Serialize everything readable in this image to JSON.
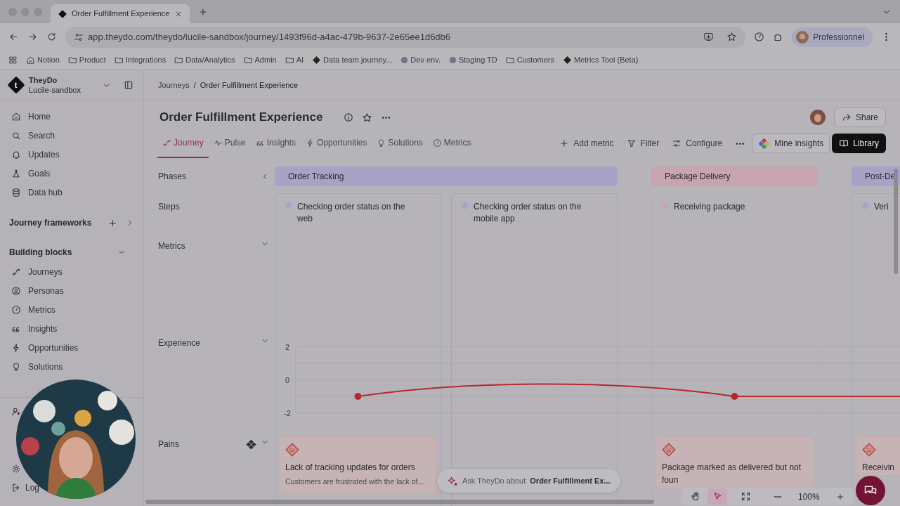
{
  "browser": {
    "tab": {
      "title": "Order Fulfillment Experience",
      "selected": true
    },
    "url": "app.theydo.com/theydo/lucile-sandbox/journey/1493f96d-a4ac-479b-9637-2e65ee1d6db6",
    "profile": "Professionnel",
    "bookmarks": [
      {
        "label": "Notion",
        "kind": "home"
      },
      {
        "label": "Product",
        "kind": "folder"
      },
      {
        "label": "Integrations",
        "kind": "folder"
      },
      {
        "label": "Data/Analytics",
        "kind": "folder"
      },
      {
        "label": "Admin",
        "kind": "folder"
      },
      {
        "label": "AI",
        "kind": "folder"
      },
      {
        "label": "Data team journey...",
        "kind": "logo"
      },
      {
        "label": "Dev env.",
        "kind": "site"
      },
      {
        "label": "Staging TD",
        "kind": "site"
      },
      {
        "label": "Customers",
        "kind": "folder"
      },
      {
        "label": "Metrics Tool (Beta)",
        "kind": "logo"
      }
    ]
  },
  "sidebar": {
    "logo": "t",
    "workspace": "TheyDo",
    "project": "Lucile-sandbox",
    "nav": [
      {
        "label": "Home"
      },
      {
        "label": "Search"
      },
      {
        "label": "Updates"
      },
      {
        "label": "Goals"
      },
      {
        "label": "Data hub"
      }
    ],
    "frameworks": "Journey frameworks",
    "blocks": {
      "title": "Building blocks",
      "expanded": true,
      "items": [
        {
          "label": "Journeys"
        },
        {
          "label": "Personas"
        },
        {
          "label": "Metrics"
        },
        {
          "label": "Insights"
        },
        {
          "label": "Opportunities"
        },
        {
          "label": "Solutions"
        }
      ]
    },
    "footer_label": "Log"
  },
  "main": {
    "breadcrumbs": [
      "Journeys",
      "Order Fulfillment Experience"
    ],
    "breadcrumb_separator": "/",
    "title": "Order Fulfillment Experience",
    "share_button": "Share",
    "tabs": [
      {
        "label": "Journey",
        "selected": true
      },
      {
        "label": "Pulse",
        "selected": false
      },
      {
        "label": "Insights",
        "selected": false
      },
      {
        "label": "Opportunities",
        "selected": false
      },
      {
        "label": "Solutions",
        "selected": false
      },
      {
        "label": "Metrics",
        "selected": false
      }
    ],
    "actions": [
      "Add metric",
      "Filter",
      "Configure"
    ],
    "mine_button": "Mine insights",
    "library_button": "Library"
  },
  "board": {
    "rows": [
      {
        "label": "Phases",
        "expanded": true
      },
      {
        "label": "Steps"
      },
      {
        "label": "Metrics",
        "expanded": true
      },
      {
        "label": "Experience",
        "expanded": true
      },
      {
        "label": "Pains",
        "expanded": true
      }
    ],
    "phases": [
      {
        "name": "Order Tracking",
        "color": "#a6a3c6",
        "steps": [
          {
            "title": "Checking order status on the web",
            "pain": {
              "title": "Lack of tracking updates for orders",
              "desc": "Customers are frustrated with the lack of..."
            }
          },
          {
            "title": "Checking order status on the mobile app"
          }
        ]
      },
      {
        "name": "Package Delivery",
        "color": "#c8a4b0",
        "steps": [
          {
            "title": "Receiving package",
            "pain": {
              "title": "Package marked as delivered but not foun"
            }
          }
        ]
      },
      {
        "name": "Post-De",
        "color": "#a6a3c6",
        "steps": [
          {
            "title": "Veri",
            "pain": {
              "title": "Receivin"
            }
          }
        ]
      }
    ],
    "chart_data": {
      "type": "line",
      "ylim": [
        -2,
        2
      ],
      "yticks": [
        2,
        0,
        -2
      ],
      "grid": true,
      "series": [
        {
          "color": "#b8282d",
          "marker": true,
          "values": [
            -1,
            null,
            -1,
            -1
          ]
        }
      ]
    }
  },
  "ask_bar": {
    "prefix": "Ask TheyDo about",
    "subject": "Order Fulfillment Ex..."
  },
  "zoom_toolbar": {
    "tools": [
      {
        "kind": "hand",
        "selected": false
      },
      {
        "kind": "pointer",
        "selected": true
      },
      {
        "kind": "fit",
        "selected": false
      }
    ],
    "zoom": "100%"
  }
}
